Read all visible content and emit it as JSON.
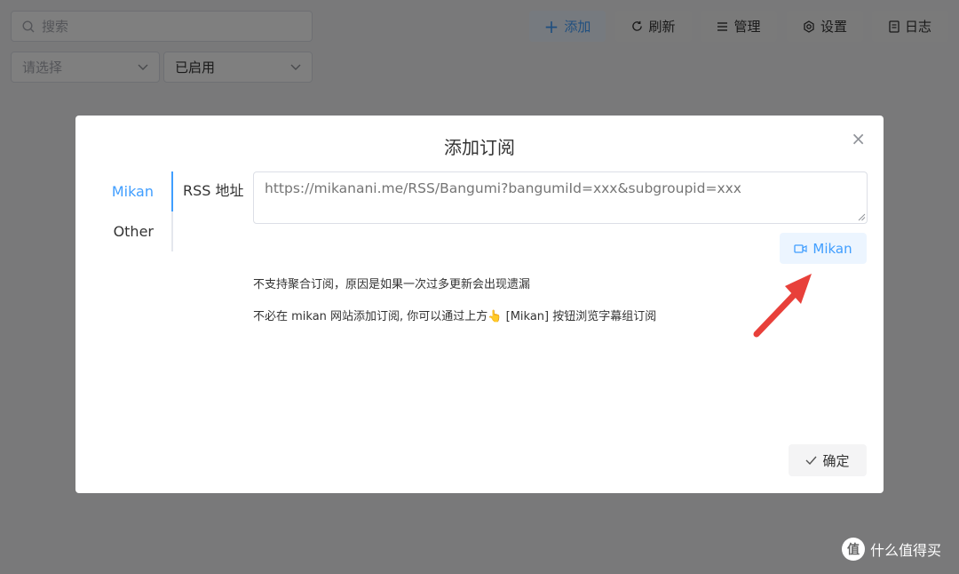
{
  "toolbar": {
    "search_placeholder": "搜索",
    "select_placeholder": "请选择",
    "status_filter": "已启用",
    "buttons": {
      "add": "添加",
      "refresh": "刷新",
      "manage": "管理",
      "settings": "设置",
      "logs": "日志"
    }
  },
  "dialog": {
    "title": "添加订阅",
    "close": "×",
    "tabs": [
      "Mikan",
      "Other"
    ],
    "rss_label": "RSS 地址",
    "rss_placeholder": "https://mikanani.me/RSS/Bangumi?bangumiId=xxx&subgroupid=xxx",
    "rss_value": "",
    "mikan_button": "Mikan",
    "hint1": "不支持聚合订阅，原因是如果一次过多更新会出现遗漏",
    "hint2": "不必在 mikan 网站添加订阅, 你可以通过上方👆 [Mikan] 按钮浏览字幕组订阅",
    "confirm": "确定"
  },
  "watermark": {
    "logo": "值",
    "text": "什么值得买"
  },
  "colors": {
    "accent": "#409eff",
    "arrow": "#e8403a"
  }
}
